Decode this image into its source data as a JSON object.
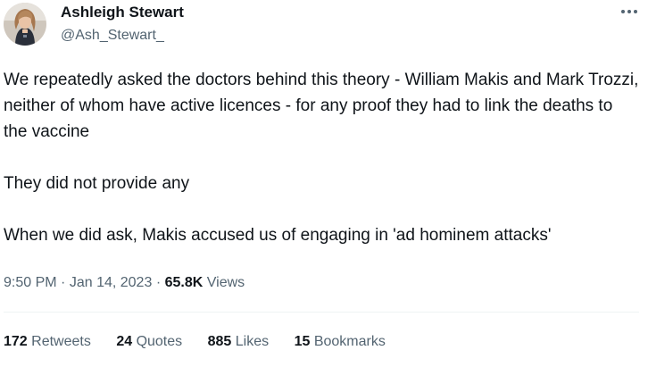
{
  "author": {
    "display_name": "Ashleigh Stewart",
    "handle": "@Ash_Stewart_",
    "avatar_icon": "profile-photo-avatar"
  },
  "more_icon": "more-horizontal-icon",
  "tweet": {
    "paragraphs": [
      "We repeatedly asked the doctors behind this theory - William Makis and Mark Trozzi, neither of whom have active licences - for any proof they had to link the deaths to the vaccine",
      "They did not provide any",
      "When we did ask, Makis accused us of engaging in 'ad hominem attacks'"
    ]
  },
  "meta": {
    "time": "9:50 PM",
    "separator": "·",
    "date": "Jan 14, 2023",
    "views_count": "65.8K",
    "views_label": "Views"
  },
  "stats": [
    {
      "count": "172",
      "label": "Retweets"
    },
    {
      "count": "24",
      "label": "Quotes"
    },
    {
      "count": "885",
      "label": "Likes"
    },
    {
      "count": "15",
      "label": "Bookmarks"
    }
  ],
  "colors": {
    "text_primary": "#0f1419",
    "text_secondary": "#536471",
    "divider": "#eff3f4"
  }
}
